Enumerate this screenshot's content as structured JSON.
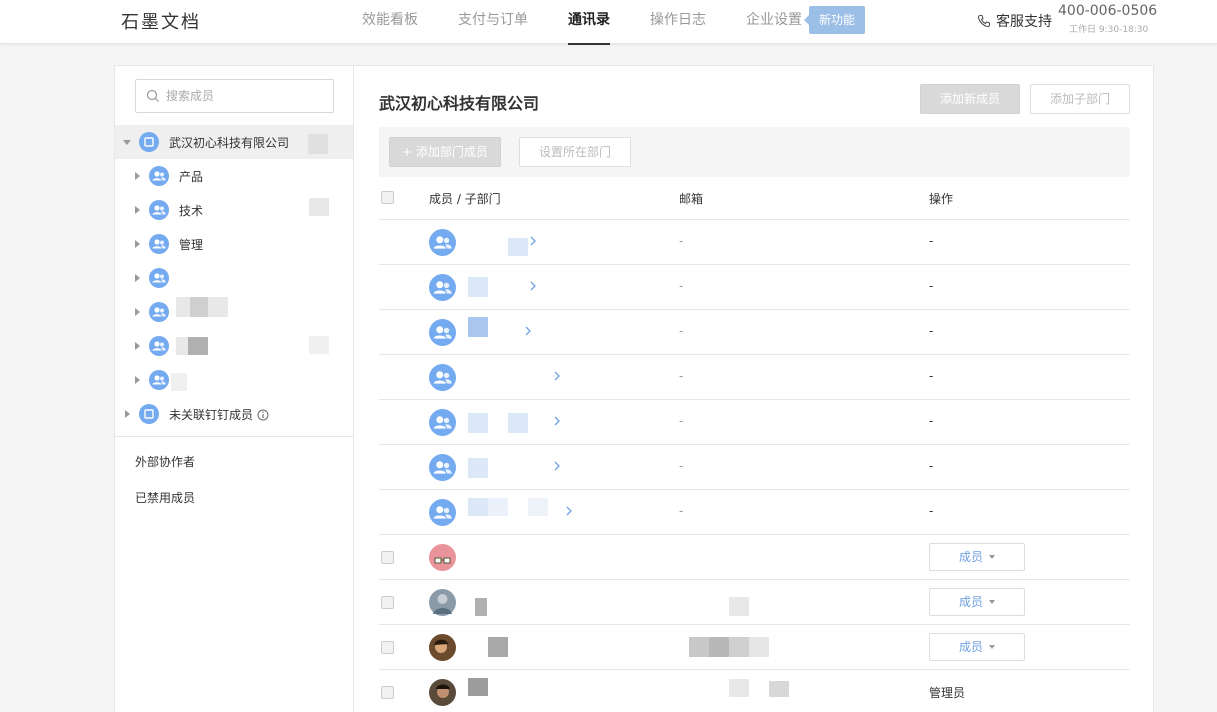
{
  "header": {
    "logo": "石墨文档",
    "nav": [
      {
        "label": "效能看板",
        "active": false
      },
      {
        "label": "支付与订单",
        "active": false
      },
      {
        "label": "通讯录",
        "active": true
      },
      {
        "label": "操作日志",
        "active": false
      },
      {
        "label": "企业设置",
        "active": false
      }
    ],
    "new_badge": "新功能",
    "support_label": "客服支持",
    "phone": "400-006-0506",
    "hours": "工作日 9:30-18:30"
  },
  "sidebar": {
    "search_placeholder": "搜索成员",
    "root": "武汉初心科技有限公司",
    "departments": [
      "产品",
      "技术",
      "管理",
      "",
      "",
      "",
      ""
    ],
    "unlinked": "未关联钉钉成员",
    "external": "外部协作者",
    "disabled": "已禁用成员"
  },
  "main": {
    "company": "武汉初心科技有限公司",
    "add_member": "添加新成员",
    "add_subdept": "添加子部门",
    "add_dept_member": "+ 添加部门成员",
    "set_dept": "设置所在部门",
    "columns": {
      "member": "成员 / 子部门",
      "email": "邮箱",
      "ops": "操作"
    },
    "dept_placeholder": "-",
    "member_roles": [
      "成员",
      "成员",
      "成员",
      "管理员"
    ]
  },
  "colors": {
    "accent": "#74aaf0",
    "badge": "#9cbfe8",
    "link": "#6fa2e0"
  }
}
